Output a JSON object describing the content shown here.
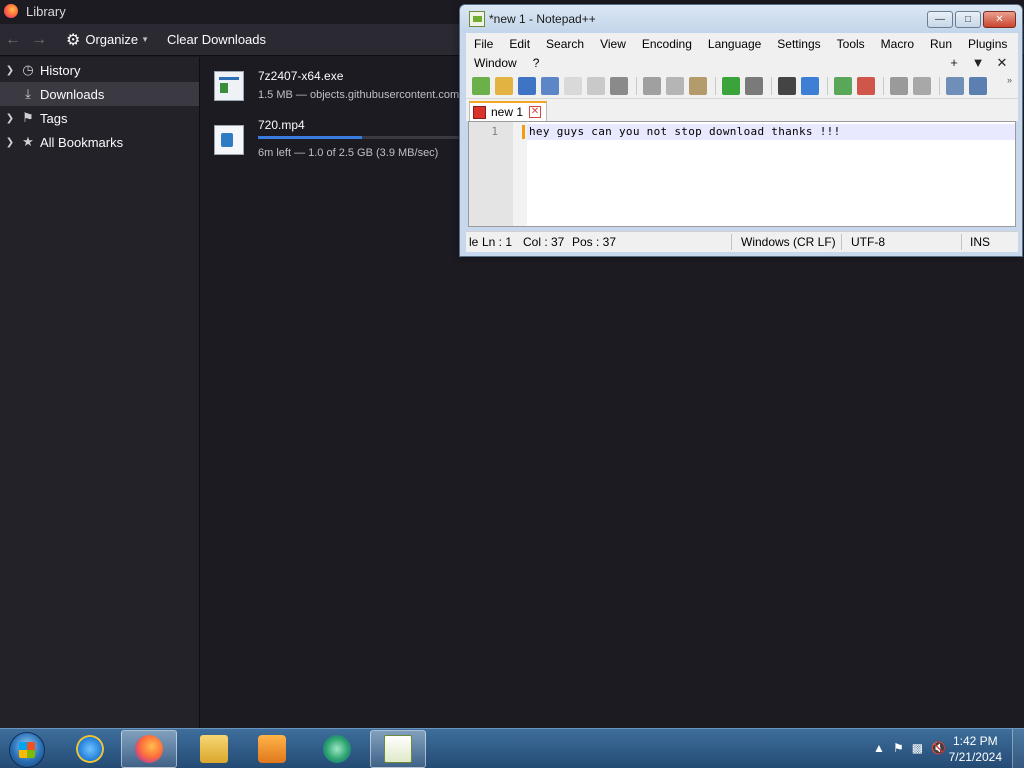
{
  "library": {
    "title": "Library",
    "toolbar": {
      "back_icon": "arrow-left-icon",
      "forward_icon": "arrow-right-icon",
      "organize_label": "Organize",
      "clear_downloads_label": "Clear Downloads"
    },
    "sidebar": {
      "items": [
        {
          "label": "History",
          "icon": "clock-icon",
          "expandable": true,
          "selected": false
        },
        {
          "label": "Downloads",
          "icon": "download-icon",
          "expandable": false,
          "selected": true
        },
        {
          "label": "Tags",
          "icon": "tag-icon",
          "expandable": true,
          "selected": false
        },
        {
          "label": "All Bookmarks",
          "icon": "star-icon",
          "expandable": true,
          "selected": false
        }
      ]
    },
    "downloads": [
      {
        "name": "7z2407-x64.exe",
        "status": "1.5 MB — objects.githubusercontent.com",
        "icon": "exe-file-icon"
      },
      {
        "name": "720.mp4",
        "status": "6m left — 1.0 of 2.5 GB (3.9 MB/sec)",
        "icon": "video-file-icon",
        "progress": 0.4
      }
    ]
  },
  "notepad": {
    "title": "*new 1 - Notepad++",
    "menu": {
      "row1": [
        "File",
        "Edit",
        "Search",
        "View",
        "Encoding",
        "Language",
        "Settings",
        "Tools",
        "Macro",
        "Run",
        "Plugins"
      ],
      "row2": [
        "Window",
        "?"
      ],
      "right_controls": [
        "+",
        "▼",
        "✕"
      ]
    },
    "tab": {
      "label": "new 1"
    },
    "editor": {
      "line_number": "1",
      "text": "hey guys can you not stop download thanks !!!"
    },
    "status": {
      "left_fragment": "le",
      "ln": "Ln : 1",
      "col": "Col : 37",
      "pos": "Pos : 37",
      "eol": "Windows (CR LF)",
      "encoding": "UTF-8",
      "mode": "INS"
    }
  },
  "taskbar": {
    "clock_time": "1:42 PM",
    "clock_date": "7/21/2024"
  },
  "colors": {
    "firefox_bg": "#1c1b22",
    "firefox_toolbar": "#2b2a33",
    "progress_fill": "#3a7be0",
    "npp_tab_accent": "#f5a623",
    "taskbar": "#2f5c89"
  }
}
